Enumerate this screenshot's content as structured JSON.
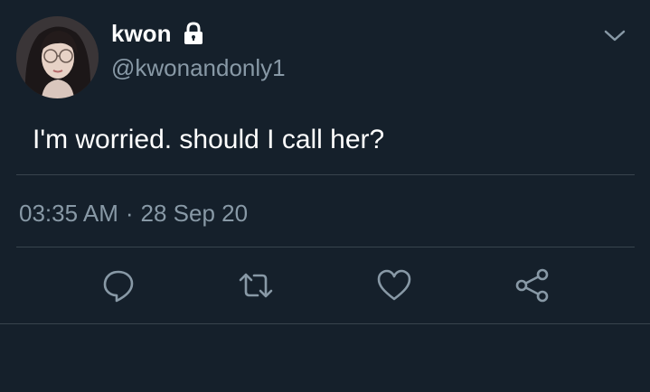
{
  "tweet": {
    "display_name": "kwon",
    "handle": "@kwonandonly1",
    "protected": true,
    "text": "I'm worried. should I call her?",
    "time": "03:35 AM",
    "separator": "·",
    "date": "28 Sep 20"
  },
  "icons": {
    "lock": "lock-icon",
    "caret": "chevron-down-icon",
    "reply": "reply-icon",
    "retweet": "retweet-icon",
    "like": "heart-icon",
    "share": "share-icon"
  },
  "colors": {
    "background": "#15202b",
    "primary_text": "#ffffff",
    "secondary_text": "#8899a6",
    "divider": "#38444d"
  }
}
